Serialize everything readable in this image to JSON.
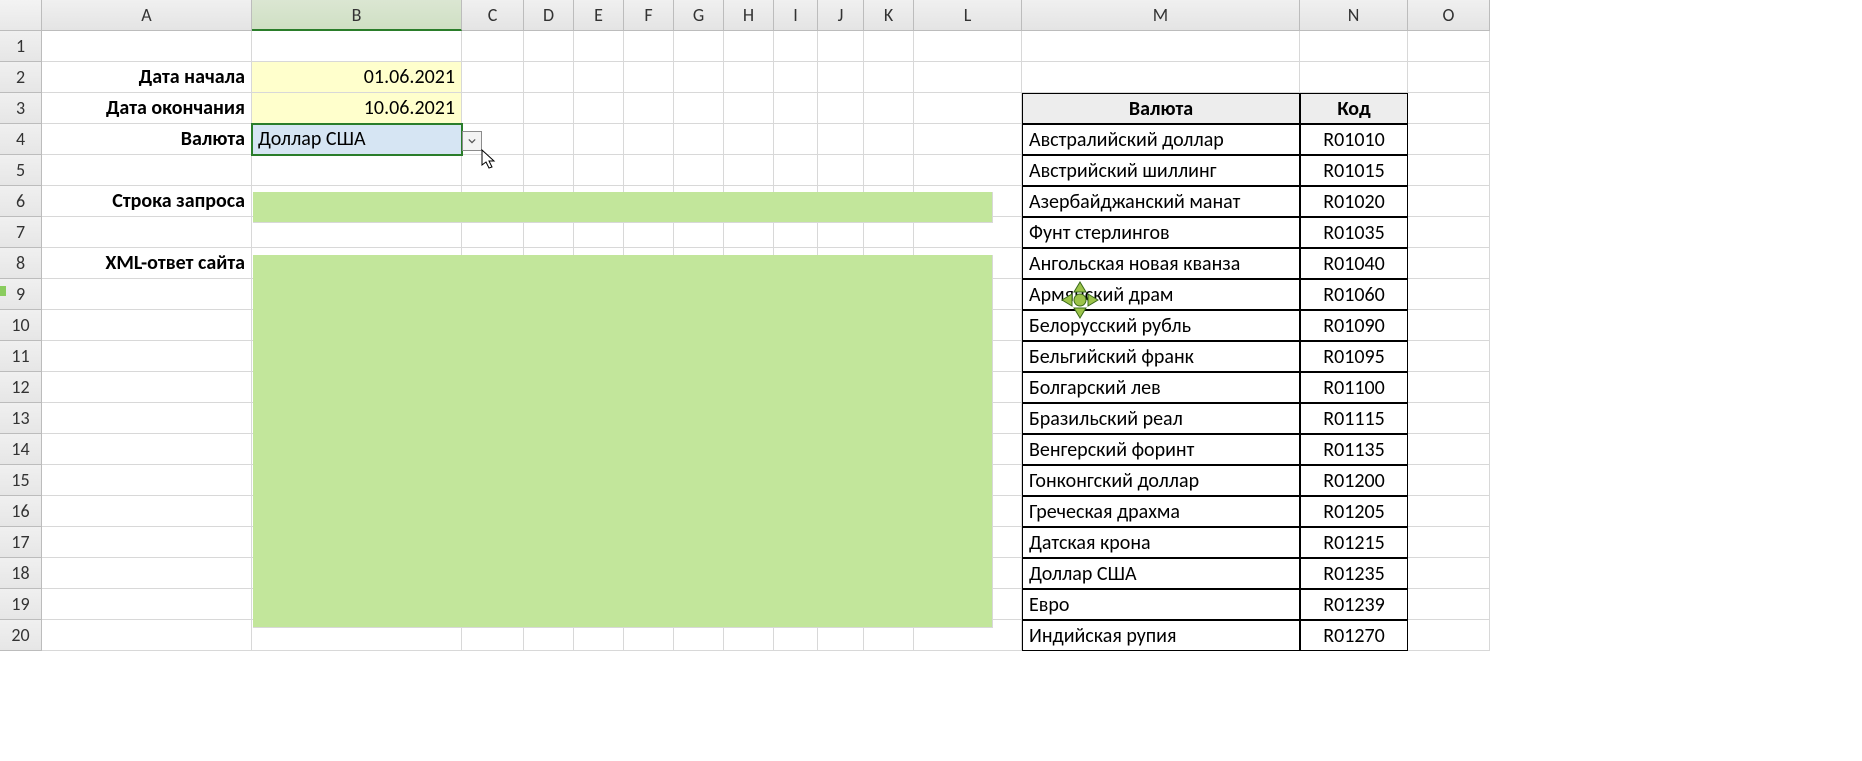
{
  "columns": [
    "A",
    "B",
    "C",
    "D",
    "E",
    "F",
    "G",
    "H",
    "I",
    "J",
    "K",
    "L",
    "M",
    "N",
    "O"
  ],
  "rows": [
    "1",
    "2",
    "3",
    "4",
    "5",
    "6",
    "7",
    "8",
    "9",
    "10",
    "11",
    "12",
    "13",
    "14",
    "15",
    "16",
    "17",
    "18",
    "19",
    "20"
  ],
  "labels": {
    "A2": "Дата начала",
    "A3": "Дата окончания",
    "A4": "Валюта",
    "A6": "Строка запроса",
    "A8": "XML-ответ сайта"
  },
  "values": {
    "B2": "01.06.2021",
    "B3": "10.06.2021",
    "B4": "Доллар США"
  },
  "table": {
    "header": {
      "currency": "Валюта",
      "code": "Код"
    },
    "rows": [
      {
        "name": "Австралийский доллар",
        "code": "R01010"
      },
      {
        "name": "Австрийский шиллинг",
        "code": "R01015"
      },
      {
        "name": "Азербайджанский манат",
        "code": "R01020"
      },
      {
        "name": "Фунт стерлингов",
        "code": "R01035"
      },
      {
        "name": "Ангольская новая кванза",
        "code": "R01040"
      },
      {
        "name": "Армянский драм",
        "code": "R01060"
      },
      {
        "name": "Белорусский рубль",
        "code": "R01090"
      },
      {
        "name": "Бельгийский франк",
        "code": "R01095"
      },
      {
        "name": "Болгарский лев",
        "code": "R01100"
      },
      {
        "name": "Бразильский реал",
        "code": "R01115"
      },
      {
        "name": "Венгерский форинт",
        "code": "R01135"
      },
      {
        "name": "Гонконгский доллар",
        "code": "R01200"
      },
      {
        "name": "Греческая драхма",
        "code": "R01205"
      },
      {
        "name": "Датская крона",
        "code": "R01215"
      },
      {
        "name": "Доллар США",
        "code": "R01235"
      },
      {
        "name": "Евро",
        "code": "R01239"
      },
      {
        "name": "Индийская рупия",
        "code": "R01270"
      }
    ]
  }
}
